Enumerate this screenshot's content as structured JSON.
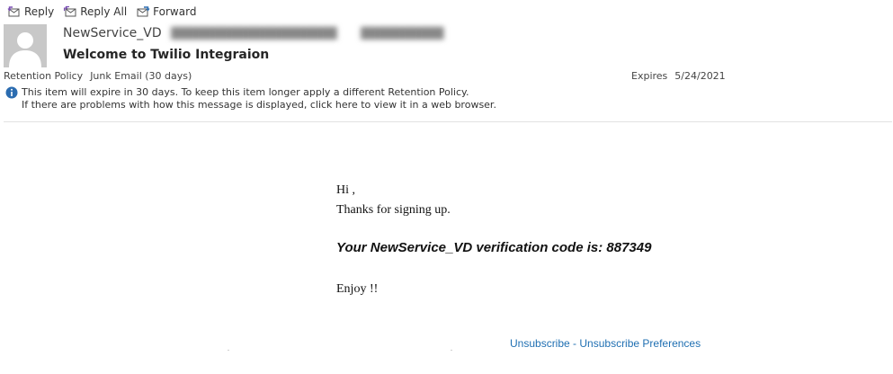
{
  "toolbar": {
    "reply_label": "Reply",
    "reply_all_label": "Reply All",
    "forward_label": "Forward"
  },
  "header": {
    "sender_name": "NewService_VD",
    "subject": "Welcome to Twilio Integraion",
    "retention_label": "Retention Policy",
    "retention_policy": "Junk Email (30 days)",
    "expires_label": "Expires",
    "expires_date": "5/24/2021",
    "info_line1": "This item will expire in 30 days. To keep this item longer apply a different Retention Policy.",
    "info_line2": "If there are problems with how this message is displayed, click here to view it in a web browser."
  },
  "message": {
    "greeting": "Hi ,",
    "thanks": "Thanks for signing up.",
    "code_line": "Your NewService_VD verification code is: 887349",
    "closing": "Enjoy !!",
    "unsubscribe_label": "Unsubscribe",
    "separator": " - ",
    "preferences_label": "Unsubscribe Preferences"
  },
  "colors": {
    "link": "#1f6fb2",
    "info_icon": "#2b6cb0",
    "avatar_bg": "#c8c8c8"
  },
  "icons": [
    "reply-icon",
    "reply-all-icon",
    "forward-icon",
    "avatar-silhouette-icon",
    "info-icon"
  ]
}
